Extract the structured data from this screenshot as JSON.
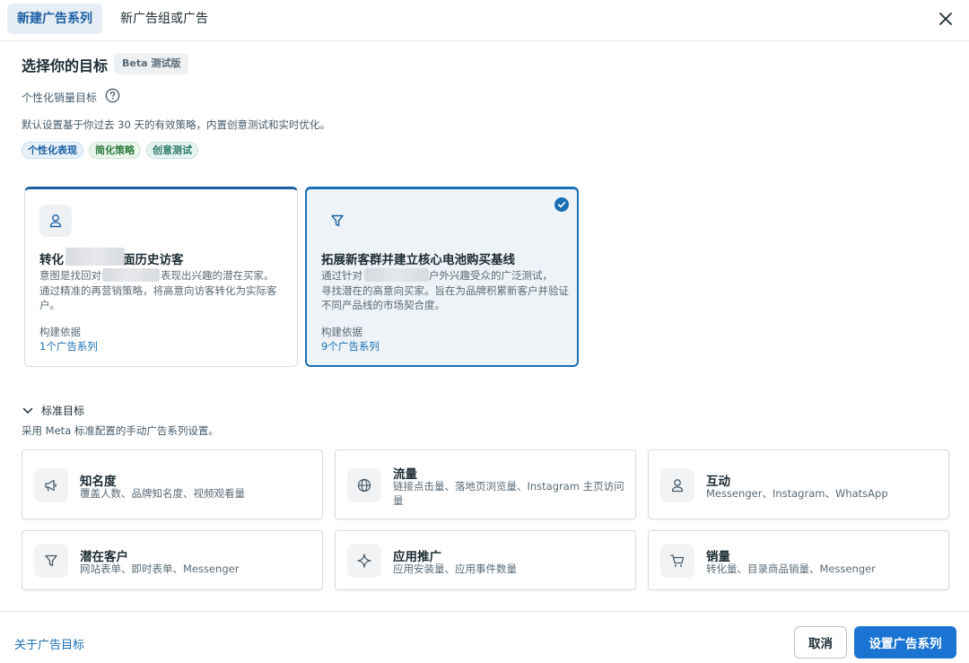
{
  "tabs": [
    {
      "label": "新建广告系列",
      "active": true
    },
    {
      "label": "新广告组或广告",
      "active": false
    }
  ],
  "header": {
    "title": "选择你的目标",
    "badge": "Beta 测试版"
  },
  "personalized": {
    "label": "个性化销量目标",
    "description": "默认设置基于你过去 30 天的有效策略，内置创意测试和实时优化。",
    "tags": [
      "个性化表现",
      "简化策略",
      "创意测试"
    ]
  },
  "objective_cards": [
    {
      "icon": "person-icon",
      "title_visible_start": "转化",
      "title_visible_end": "面历史访客",
      "desc_line1_start": "意图是找回对",
      "desc_line1_end": "表现出兴趣的潜在买家。",
      "desc_rest": "通过精准的再营销策略，将高意向访客转化为实际客户。",
      "basis_label": "构建依据",
      "basis_link": "1个广告系列",
      "selected": false
    },
    {
      "icon": "funnel-icon",
      "title": "拓展新客群并建立核心电池购买基线",
      "desc_line1_start": "通过针对",
      "desc_line1_end": "户外兴趣受众的广泛测试，",
      "desc_rest": "寻找潜在的高意向买家。旨在为品牌积累新客户并验证不同产品线的市场契合度。",
      "basis_label": "构建依据",
      "basis_link": "9个广告系列",
      "selected": true
    }
  ],
  "standard": {
    "label": "标准目标",
    "description": "采用 Meta 标准配置的手动广告系列设置。",
    "items": [
      {
        "icon": "megaphone-icon",
        "title": "知名度",
        "subtitle": "覆盖人数、品牌知名度、视频观看量"
      },
      {
        "icon": "globe-icon",
        "title": "流量",
        "subtitle": "链接点击量、落地页浏览量、Instagram 主页访问量"
      },
      {
        "icon": "person-icon",
        "title": "互动",
        "subtitle": "Messenger、Instagram、WhatsApp"
      },
      {
        "icon": "funnel-icon",
        "title": "潜在客户",
        "subtitle": "网站表单、即时表单、Messenger"
      },
      {
        "icon": "sparkle-icon",
        "title": "应用推广",
        "subtitle": "应用安装量、应用事件数量"
      },
      {
        "icon": "cart-icon",
        "title": "销量",
        "subtitle": "转化量、目录商品销量、Messenger"
      }
    ]
  },
  "footer": {
    "link": "关于广告目标",
    "cancel": "取消",
    "primary": "设置广告系列"
  },
  "colors": {
    "accent": "#1b74d1",
    "link": "#1a6fb3",
    "selected_bg": "#eef3f8"
  }
}
